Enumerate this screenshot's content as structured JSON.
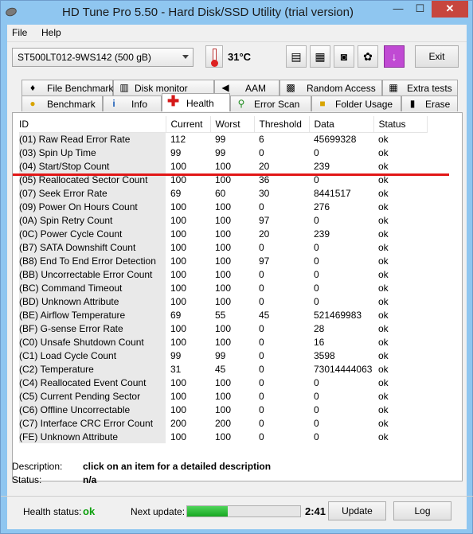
{
  "window": {
    "title": "HD Tune Pro 5.50 - Hard Disk/SSD Utility (trial version)",
    "minimize": "—",
    "maximize": "☐",
    "close": "✕"
  },
  "menu": {
    "file": "File",
    "help": "Help"
  },
  "toolbar": {
    "drive": "ST500LT012-9WS142 (500 gB)",
    "temperature": "31°C",
    "exit": "Exit"
  },
  "tabs_top": [
    "File Benchmark",
    "Disk monitor",
    "AAM",
    "Random Access",
    "Extra tests"
  ],
  "tabs_bottom": [
    "Benchmark",
    "Info",
    "Health",
    "Error Scan",
    "Folder Usage",
    "Erase"
  ],
  "active_tab": "Health",
  "table": {
    "headers": [
      "ID",
      "Current",
      "Worst",
      "Threshold",
      "Data",
      "Status"
    ],
    "rows": [
      [
        "(01) Raw Read Error Rate",
        "112",
        "99",
        "6",
        "45699328",
        "ok"
      ],
      [
        "(03) Spin Up Time",
        "99",
        "99",
        "0",
        "0",
        "ok"
      ],
      [
        "(04) Start/Stop Count",
        "100",
        "100",
        "20",
        "239",
        "ok"
      ],
      [
        "(05) Reallocated Sector Count",
        "100",
        "100",
        "36",
        "0",
        "ok"
      ],
      [
        "(07) Seek Error Rate",
        "69",
        "60",
        "30",
        "8441517",
        "ok"
      ],
      [
        "(09) Power On Hours Count",
        "100",
        "100",
        "0",
        "276",
        "ok"
      ],
      [
        "(0A) Spin Retry Count",
        "100",
        "100",
        "97",
        "0",
        "ok"
      ],
      [
        "(0C) Power Cycle Count",
        "100",
        "100",
        "20",
        "239",
        "ok"
      ],
      [
        "(B7) SATA Downshift Count",
        "100",
        "100",
        "0",
        "0",
        "ok"
      ],
      [
        "(B8) End To End Error Detection",
        "100",
        "100",
        "97",
        "0",
        "ok"
      ],
      [
        "(BB) Uncorrectable Error Count",
        "100",
        "100",
        "0",
        "0",
        "ok"
      ],
      [
        "(BC) Command Timeout",
        "100",
        "100",
        "0",
        "0",
        "ok"
      ],
      [
        "(BD) Unknown Attribute",
        "100",
        "100",
        "0",
        "0",
        "ok"
      ],
      [
        "(BE) Airflow Temperature",
        "69",
        "55",
        "45",
        "521469983",
        "ok"
      ],
      [
        "(BF) G-sense Error Rate",
        "100",
        "100",
        "0",
        "28",
        "ok"
      ],
      [
        "(C0) Unsafe Shutdown Count",
        "100",
        "100",
        "0",
        "16",
        "ok"
      ],
      [
        "(C1) Load Cycle Count",
        "99",
        "99",
        "0",
        "3598",
        "ok"
      ],
      [
        "(C2) Temperature",
        "31",
        "45",
        "0",
        "73014444063",
        "ok"
      ],
      [
        "(C4) Reallocated Event Count",
        "100",
        "100",
        "0",
        "0",
        "ok"
      ],
      [
        "(C5) Current Pending Sector",
        "100",
        "100",
        "0",
        "0",
        "ok"
      ],
      [
        "(C6) Offline Uncorrectable",
        "100",
        "100",
        "0",
        "0",
        "ok"
      ],
      [
        "(C7) Interface CRC Error Count",
        "200",
        "200",
        "0",
        "0",
        "ok"
      ],
      [
        "(FE) Unknown Attribute",
        "100",
        "100",
        "0",
        "0",
        "ok"
      ]
    ]
  },
  "description": {
    "label": "Description:",
    "value": "click on an item for a detailed description",
    "status_label": "Status:",
    "status_value": "n/a"
  },
  "bottom": {
    "health_label": "Health status:",
    "health_value": "ok",
    "next_label": "Next update:",
    "progress": 0.36,
    "countdown": "2:41",
    "update": "Update",
    "log": "Log"
  },
  "colors": {
    "title_bar": "#8fc6f0",
    "marker_line": "#e21717",
    "health_ok": "#0ea00e",
    "progress": "#18a722"
  }
}
